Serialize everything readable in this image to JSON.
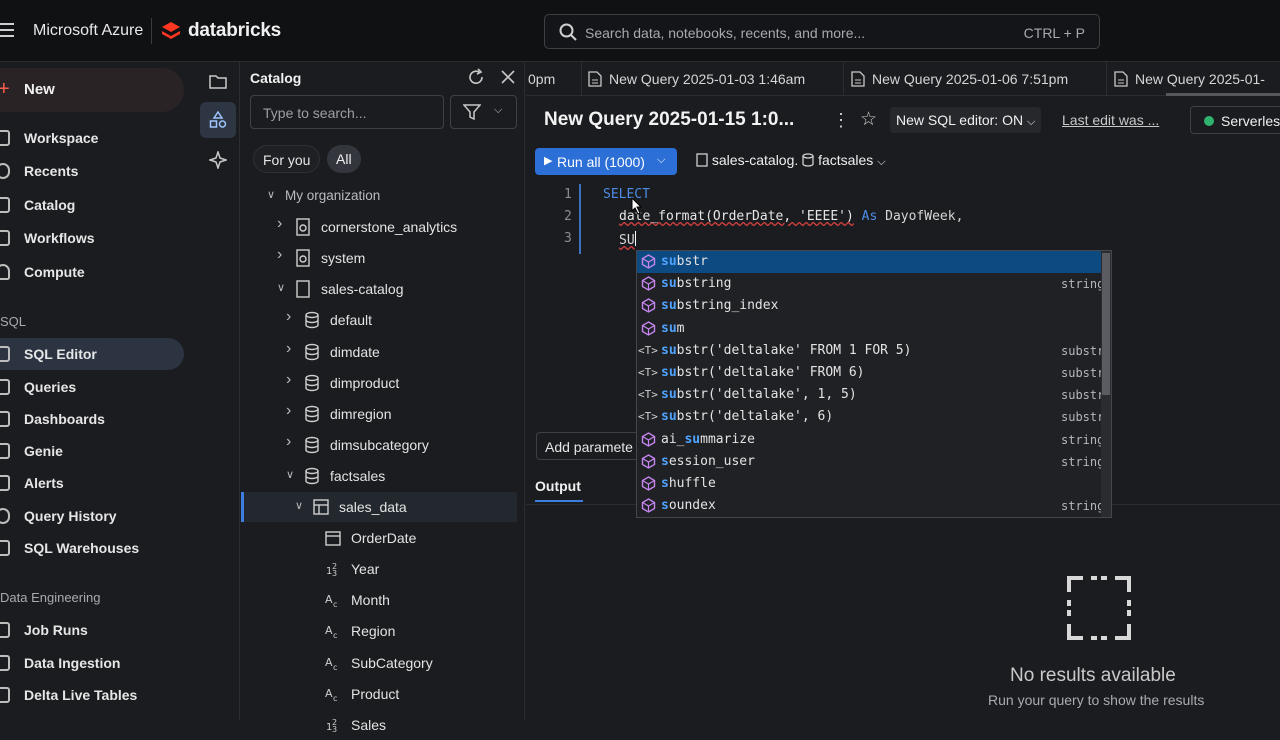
{
  "topbar": {
    "brand": "Microsoft Azure",
    "product": "databricks",
    "search_placeholder": "Search data, notebooks, recents, and more...",
    "search_shortcut": "CTRL + P",
    "brand_color": "#ff3621"
  },
  "leftnav": {
    "new_label": "New",
    "items_top": [
      {
        "label": "Workspace",
        "icon": "folder-icon"
      },
      {
        "label": "Recents",
        "icon": "clock-icon"
      },
      {
        "label": "Catalog",
        "icon": "catalog-icon"
      },
      {
        "label": "Workflows",
        "icon": "workflows-icon"
      },
      {
        "label": "Compute",
        "icon": "cloud-icon"
      }
    ],
    "sql_section": "SQL",
    "items_sql": [
      {
        "label": "SQL Editor",
        "icon": "sql-editor-icon",
        "active": true
      },
      {
        "label": "Queries",
        "icon": "queries-icon"
      },
      {
        "label": "Dashboards",
        "icon": "dashboard-icon"
      },
      {
        "label": "Genie",
        "icon": "genie-icon"
      },
      {
        "label": "Alerts",
        "icon": "bell-icon"
      },
      {
        "label": "Query History",
        "icon": "history-icon"
      },
      {
        "label": "SQL Warehouses",
        "icon": "warehouse-icon"
      }
    ],
    "de_section": "Data Engineering",
    "items_de": [
      {
        "label": "Job Runs",
        "icon": "job-runs-icon"
      },
      {
        "label": "Data Ingestion",
        "icon": "ingestion-icon"
      },
      {
        "label": "Delta Live Tables",
        "icon": "dlt-icon"
      }
    ]
  },
  "catalog": {
    "title": "Catalog",
    "search_placeholder": "Type to search...",
    "chips": [
      "For you",
      "All"
    ],
    "tree": [
      {
        "label": "My organization",
        "level": 0,
        "kind": "group",
        "open": true
      },
      {
        "label": "cornerstone_analytics",
        "level": 1,
        "kind": "catalog",
        "open": false
      },
      {
        "label": "system",
        "level": 1,
        "kind": "catalog",
        "open": false
      },
      {
        "label": "sales-catalog",
        "level": 1,
        "kind": "catalog-open",
        "open": true
      },
      {
        "label": "default",
        "level": 2,
        "kind": "schema",
        "open": false
      },
      {
        "label": "dimdate",
        "level": 2,
        "kind": "schema",
        "open": false
      },
      {
        "label": "dimproduct",
        "level": 2,
        "kind": "schema",
        "open": false
      },
      {
        "label": "dimregion",
        "level": 2,
        "kind": "schema",
        "open": false
      },
      {
        "label": "dimsubcategory",
        "level": 2,
        "kind": "schema",
        "open": false
      },
      {
        "label": "factsales",
        "level": 2,
        "kind": "schema",
        "open": true
      },
      {
        "label": "sales_data",
        "level": 3,
        "kind": "table",
        "open": true
      },
      {
        "label": "OrderDate",
        "level": 4,
        "kind": "date-col"
      },
      {
        "label": "Year",
        "level": 4,
        "kind": "num-col"
      },
      {
        "label": "Month",
        "level": 4,
        "kind": "str-col"
      },
      {
        "label": "Region",
        "level": 4,
        "kind": "str-col"
      },
      {
        "label": "SubCategory",
        "level": 4,
        "kind": "str-col"
      },
      {
        "label": "Product",
        "level": 4,
        "kind": "str-col"
      },
      {
        "label": "Sales",
        "level": 4,
        "kind": "num-col"
      }
    ]
  },
  "tabs": [
    {
      "label": "0pm"
    },
    {
      "label": "New Query 2025-01-03 1:46am"
    },
    {
      "label": "New Query 2025-01-06 7:51pm"
    },
    {
      "label": "New Query 2025-01-"
    }
  ],
  "query": {
    "title": "New Query 2025-01-15 1:0...",
    "sql_editor_toggle": "New SQL editor: ON",
    "last_edit": "Last edit was ...",
    "compute": "Serverless",
    "run_label": "Run all (1000)",
    "catalog": "sales-catalog",
    "schema": "factsales",
    "add_parameter": "Add paramete",
    "output_tab": "Output",
    "no_results_title": "No results available",
    "no_results_sub": "Run your query to show the results"
  },
  "code": {
    "line_numbers": [
      "1",
      "2",
      "3"
    ],
    "line1": "SELECT",
    "line2_fn": "date_format(OrderDate, 'EEEE')",
    "line2_as": "As",
    "line2_alias": "DayofWeek,",
    "line3": "SU"
  },
  "autocomplete": [
    {
      "match": "su",
      "rest": "bstr",
      "type": "",
      "kind": "function"
    },
    {
      "match": "su",
      "rest": "bstring",
      "type": "string",
      "kind": "function"
    },
    {
      "match": "su",
      "rest": "bstring_index",
      "type": "",
      "kind": "function"
    },
    {
      "match": "su",
      "rest": "m",
      "type": "",
      "kind": "function"
    },
    {
      "match": "su",
      "rest": "bstr('deltalake' FROM 1 FOR 5)",
      "type": "substr",
      "kind": "snippet"
    },
    {
      "match": "su",
      "rest": "bstr('deltalake' FROM 6)",
      "type": "substr",
      "kind": "snippet"
    },
    {
      "match": "su",
      "rest": "bstr('deltalake', 1, 5)",
      "type": "substr",
      "kind": "snippet"
    },
    {
      "match": "su",
      "rest": "bstr('deltalake', 6)",
      "type": "substr",
      "kind": "snippet"
    },
    {
      "pre": "ai_",
      "match": "su",
      "rest": "mmarize",
      "type": "string",
      "kind": "function"
    },
    {
      "match": "s",
      "rest": "ession_user",
      "type": "string",
      "kind": "function"
    },
    {
      "match": "s",
      "rest": "huffle",
      "type": "",
      "kind": "function"
    },
    {
      "match": "s",
      "rest": "oundex",
      "type": "string",
      "kind": "function"
    }
  ]
}
